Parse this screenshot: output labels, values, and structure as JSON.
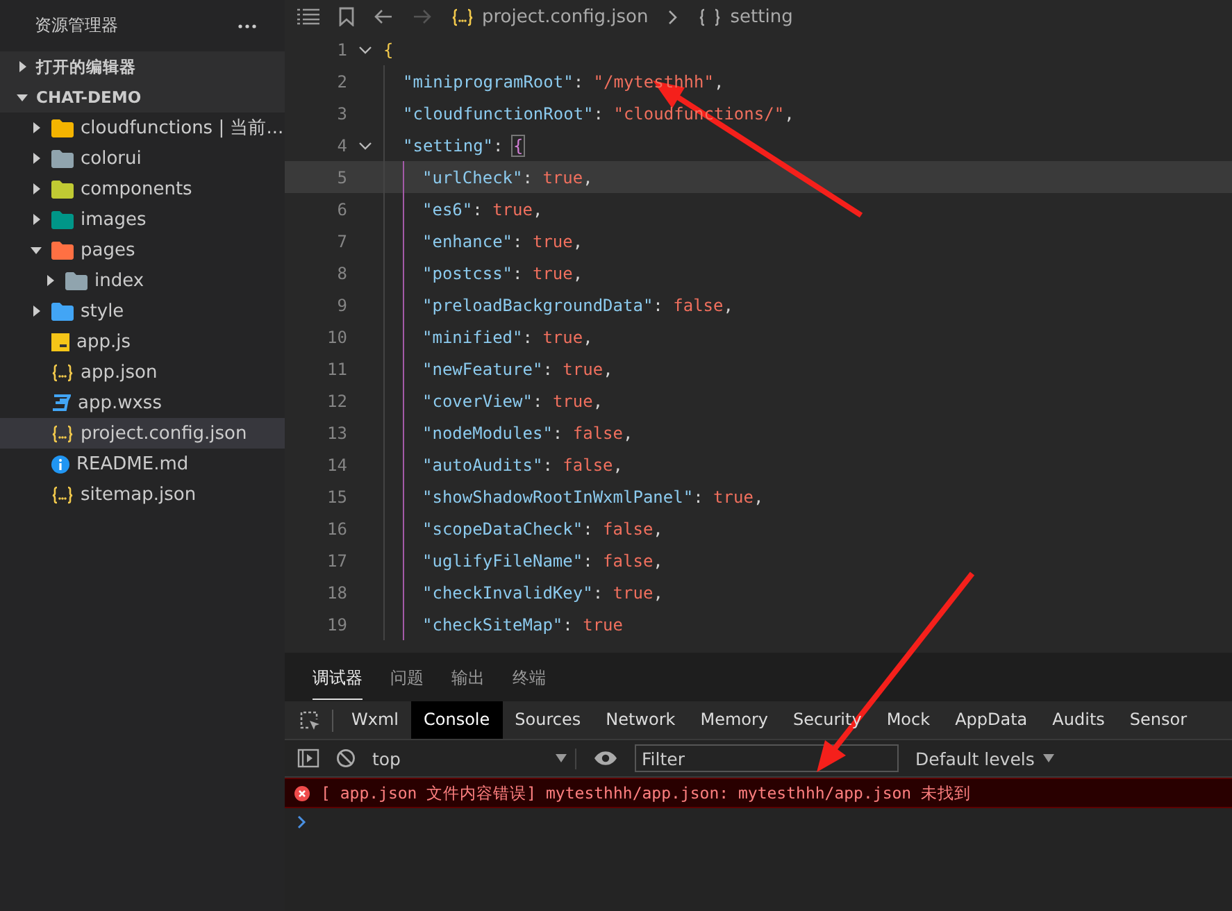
{
  "sidebar": {
    "title": "资源管理器",
    "sections": [
      {
        "label": "打开的编辑器",
        "expanded": false
      },
      {
        "label": "CHAT-DEMO",
        "expanded": true,
        "children": [
          {
            "label": "cloudfunctions | 当前...",
            "kind": "folder",
            "color": "#f4b400",
            "expanded": false,
            "selected": false
          },
          {
            "label": "colorui",
            "kind": "folder",
            "color": "#90a4ae",
            "expanded": false,
            "selected": false
          },
          {
            "label": "components",
            "kind": "folder",
            "color": "#c0ca33",
            "expanded": false,
            "selected": false
          },
          {
            "label": "images",
            "kind": "folder",
            "color": "#009688",
            "expanded": false,
            "selected": false
          },
          {
            "label": "pages",
            "kind": "folder",
            "color": "#ff7043",
            "expanded": true,
            "selected": false,
            "children": [
              {
                "label": "index",
                "kind": "folder",
                "color": "#90a4ae",
                "expanded": false,
                "selected": false
              }
            ]
          },
          {
            "label": "style",
            "kind": "folder",
            "color": "#42a5f5",
            "expanded": false,
            "selected": false
          },
          {
            "label": "app.js",
            "kind": "js",
            "selected": false
          },
          {
            "label": "app.json",
            "kind": "json",
            "selected": false
          },
          {
            "label": "app.wxss",
            "kind": "css",
            "selected": false
          },
          {
            "label": "project.config.json",
            "kind": "json",
            "selected": true
          },
          {
            "label": "README.md",
            "kind": "info",
            "selected": false
          },
          {
            "label": "sitemap.json",
            "kind": "json",
            "selected": false
          }
        ]
      }
    ]
  },
  "editor": {
    "breadcrumb": {
      "file": "project.config.json",
      "symbol": "setting"
    },
    "lines": [
      {
        "number": "1",
        "current": false,
        "tokens": [
          {
            "kind": "brace",
            "text": "{"
          }
        ],
        "children": [
          {
            "number": "2",
            "current": false,
            "tokens": [
              {
                "kind": "key",
                "text": "\"miniprogramRoot\""
              },
              {
                "kind": "punct",
                "text": ": "
              },
              {
                "kind": "string",
                "text": "\"/mytesthhh\""
              },
              {
                "kind": "punct",
                "text": ","
              }
            ]
          },
          {
            "number": "3",
            "current": false,
            "tokens": [
              {
                "kind": "key",
                "text": "\"cloudfunctionRoot\""
              },
              {
                "kind": "punct",
                "text": ": "
              },
              {
                "kind": "string",
                "text": "\"cloudfunctions/\""
              },
              {
                "kind": "punct",
                "text": ","
              }
            ]
          },
          {
            "number": "4",
            "current": false,
            "tokens": [
              {
                "kind": "key",
                "text": "\"setting\""
              },
              {
                "kind": "punct",
                "text": ": "
              },
              {
                "kind": "match",
                "text": "{"
              }
            ],
            "children": [
              {
                "number": "5",
                "current": true,
                "tokens": [
                  {
                    "kind": "key",
                    "text": "\"urlCheck\""
                  },
                  {
                    "kind": "punct",
                    "text": ": "
                  },
                  {
                    "kind": "bool",
                    "text": "true"
                  },
                  {
                    "kind": "punct",
                    "text": ","
                  }
                ]
              },
              {
                "number": "6",
                "current": false,
                "tokens": [
                  {
                    "kind": "key",
                    "text": "\"es6\""
                  },
                  {
                    "kind": "punct",
                    "text": ": "
                  },
                  {
                    "kind": "bool",
                    "text": "true"
                  },
                  {
                    "kind": "punct",
                    "text": ","
                  }
                ]
              },
              {
                "number": "7",
                "current": false,
                "tokens": [
                  {
                    "kind": "key",
                    "text": "\"enhance\""
                  },
                  {
                    "kind": "punct",
                    "text": ": "
                  },
                  {
                    "kind": "bool",
                    "text": "true"
                  },
                  {
                    "kind": "punct",
                    "text": ","
                  }
                ]
              },
              {
                "number": "8",
                "current": false,
                "tokens": [
                  {
                    "kind": "key",
                    "text": "\"postcss\""
                  },
                  {
                    "kind": "punct",
                    "text": ": "
                  },
                  {
                    "kind": "bool",
                    "text": "true"
                  },
                  {
                    "kind": "punct",
                    "text": ","
                  }
                ]
              },
              {
                "number": "9",
                "current": false,
                "tokens": [
                  {
                    "kind": "key",
                    "text": "\"preloadBackgroundData\""
                  },
                  {
                    "kind": "punct",
                    "text": ": "
                  },
                  {
                    "kind": "bool",
                    "text": "false"
                  },
                  {
                    "kind": "punct",
                    "text": ","
                  }
                ]
              },
              {
                "number": "10",
                "current": false,
                "tokens": [
                  {
                    "kind": "key",
                    "text": "\"minified\""
                  },
                  {
                    "kind": "punct",
                    "text": ": "
                  },
                  {
                    "kind": "bool",
                    "text": "true"
                  },
                  {
                    "kind": "punct",
                    "text": ","
                  }
                ]
              },
              {
                "number": "11",
                "current": false,
                "tokens": [
                  {
                    "kind": "key",
                    "text": "\"newFeature\""
                  },
                  {
                    "kind": "punct",
                    "text": ": "
                  },
                  {
                    "kind": "bool",
                    "text": "true"
                  },
                  {
                    "kind": "punct",
                    "text": ","
                  }
                ]
              },
              {
                "number": "12",
                "current": false,
                "tokens": [
                  {
                    "kind": "key",
                    "text": "\"coverView\""
                  },
                  {
                    "kind": "punct",
                    "text": ": "
                  },
                  {
                    "kind": "bool",
                    "text": "true"
                  },
                  {
                    "kind": "punct",
                    "text": ","
                  }
                ]
              },
              {
                "number": "13",
                "current": false,
                "tokens": [
                  {
                    "kind": "key",
                    "text": "\"nodeModules\""
                  },
                  {
                    "kind": "punct",
                    "text": ": "
                  },
                  {
                    "kind": "bool",
                    "text": "false"
                  },
                  {
                    "kind": "punct",
                    "text": ","
                  }
                ]
              },
              {
                "number": "14",
                "current": false,
                "tokens": [
                  {
                    "kind": "key",
                    "text": "\"autoAudits\""
                  },
                  {
                    "kind": "punct",
                    "text": ": "
                  },
                  {
                    "kind": "bool",
                    "text": "false"
                  },
                  {
                    "kind": "punct",
                    "text": ","
                  }
                ]
              },
              {
                "number": "15",
                "current": false,
                "tokens": [
                  {
                    "kind": "key",
                    "text": "\"showShadowRootInWxmlPanel\""
                  },
                  {
                    "kind": "punct",
                    "text": ": "
                  },
                  {
                    "kind": "bool",
                    "text": "true"
                  },
                  {
                    "kind": "punct",
                    "text": ","
                  }
                ]
              },
              {
                "number": "16",
                "current": false,
                "tokens": [
                  {
                    "kind": "key",
                    "text": "\"scopeDataCheck\""
                  },
                  {
                    "kind": "punct",
                    "text": ": "
                  },
                  {
                    "kind": "bool",
                    "text": "false"
                  },
                  {
                    "kind": "punct",
                    "text": ","
                  }
                ]
              },
              {
                "number": "17",
                "current": false,
                "tokens": [
                  {
                    "kind": "key",
                    "text": "\"uglifyFileName\""
                  },
                  {
                    "kind": "punct",
                    "text": ": "
                  },
                  {
                    "kind": "bool",
                    "text": "false"
                  },
                  {
                    "kind": "punct",
                    "text": ","
                  }
                ]
              },
              {
                "number": "18",
                "current": false,
                "tokens": [
                  {
                    "kind": "key",
                    "text": "\"checkInvalidKey\""
                  },
                  {
                    "kind": "punct",
                    "text": ": "
                  },
                  {
                    "kind": "bool",
                    "text": "true"
                  },
                  {
                    "kind": "punct",
                    "text": ","
                  }
                ]
              },
              {
                "number": "19",
                "current": false,
                "tokens": [
                  {
                    "kind": "key",
                    "text": "\"checkSiteMap\""
                  },
                  {
                    "kind": "punct",
                    "text": ": "
                  },
                  {
                    "kind": "bool",
                    "text": "true"
                  }
                ]
              }
            ]
          }
        ]
      }
    ]
  },
  "panel": {
    "tabs": [
      {
        "label": "调试器",
        "selected": true
      },
      {
        "label": "问题",
        "selected": false
      },
      {
        "label": "输出",
        "selected": false
      },
      {
        "label": "终端",
        "selected": false
      }
    ],
    "devtools_tabs": [
      {
        "label": "Wxml",
        "selected": false
      },
      {
        "label": "Console",
        "selected": true
      },
      {
        "label": "Sources",
        "selected": false
      },
      {
        "label": "Network",
        "selected": false
      },
      {
        "label": "Memory",
        "selected": false
      },
      {
        "label": "Security",
        "selected": false
      },
      {
        "label": "Mock",
        "selected": false
      },
      {
        "label": "AppData",
        "selected": false
      },
      {
        "label": "Audits",
        "selected": false
      },
      {
        "label": "Sensor",
        "selected": false
      }
    ],
    "context": "top",
    "filter": {
      "placeholder": "Filter"
    },
    "levels": "Default levels",
    "messages": [
      {
        "kind": "error",
        "text": "[ app.json 文件内容错误] mytesthhh/app.json: mytesthhh/app.json 未找到"
      }
    ]
  }
}
